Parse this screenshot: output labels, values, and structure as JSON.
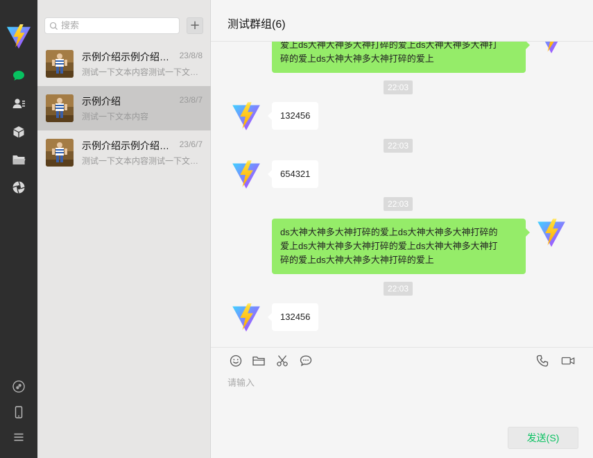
{
  "app": {
    "brand_colors": {
      "yellow": "#ffd02b",
      "purple": "#9b5cf6",
      "blue": "#41b0ff",
      "green": "#07c160"
    }
  },
  "rail": {
    "logo": "vite-logo-icon",
    "items": [
      {
        "icon": "chat-icon",
        "active": true
      },
      {
        "icon": "contacts-icon",
        "active": false
      },
      {
        "icon": "box-icon",
        "active": false
      },
      {
        "icon": "folder-icon",
        "active": false
      },
      {
        "icon": "aperture-icon",
        "active": false
      }
    ],
    "bottom": [
      {
        "icon": "link-icon"
      },
      {
        "icon": "phone-device-icon"
      },
      {
        "icon": "menu-icon"
      }
    ]
  },
  "search": {
    "placeholder": "搜索",
    "add_label": "+"
  },
  "sessions": [
    {
      "title": "示例介绍示例介绍示例介绍",
      "date": "23/8/8",
      "preview": "测试一下文本内容测试一下文本内容",
      "active": false
    },
    {
      "title": "示例介绍",
      "date": "23/8/7",
      "preview": "测试一下文本内容",
      "active": true
    },
    {
      "title": "示例介绍示例介绍示例介绍",
      "date": "23/6/7",
      "preview": "测试一下文本内容测试一下文本内容",
      "active": false
    }
  ],
  "chat": {
    "title": "测试群组(6)",
    "messages": [
      {
        "direction": "out",
        "lines": [
          "爱上ds大神大神多大神打碎的爱上ds大神大神多大神打",
          "碎的爱上ds大神大神多大神打碎的爱上"
        ]
      },
      {
        "type": "time",
        "text": "22:03"
      },
      {
        "direction": "in",
        "text": "132456"
      },
      {
        "type": "time",
        "text": "22:03"
      },
      {
        "direction": "in",
        "text": "654321"
      },
      {
        "type": "time",
        "text": "22:03"
      },
      {
        "direction": "out",
        "lines": [
          "ds大神大神多大神打碎的爱上ds大神大神多大神打碎的",
          "爱上ds大神大神多大神打碎的爱上ds大神大神多大神打",
          "碎的爱上ds大神大神多大神打碎的爱上"
        ]
      },
      {
        "type": "time",
        "text": "22:03"
      },
      {
        "direction": "in",
        "text": "132456"
      }
    ]
  },
  "composer": {
    "tools_left": [
      "emoji-icon",
      "folder-icon",
      "scissors-icon",
      "chat-bubble-icon"
    ],
    "tools_right": [
      "phone-call-icon",
      "video-call-icon"
    ],
    "placeholder": "请输入",
    "send_label": "发送(S)"
  }
}
